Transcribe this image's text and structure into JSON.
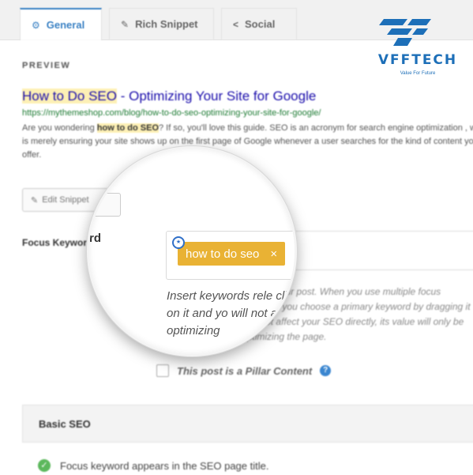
{
  "tabs": [
    {
      "label": "General",
      "icon": "gear-icon",
      "active": true
    },
    {
      "label": "Rich Snippet",
      "icon": "pin-icon",
      "active": false
    },
    {
      "label": "Social",
      "icon": "share-icon",
      "active": false
    }
  ],
  "logo": {
    "text": "VFFTECH",
    "tagline": "Value For Future",
    "color": "#1d6fb8"
  },
  "preview": {
    "heading": "PREVIEW",
    "title_keyword": "How to Do SEO",
    "title_rest": " - Optimizing Your Site for Google",
    "url": "https://mythemeshop.com/blog/how-to-do-seo-optimizing-your-site-for-google/",
    "desc_before": "Are you wondering ",
    "desc_keyword": "how to do SEO",
    "desc_after": "? If so, you'll love this guide. SEO is an acronym for search engine optimization , which is merely ensuring your site shows up on the first page of Google whenever a user searches for the kind of content you offer."
  },
  "edit_snippet": {
    "label": "Edit Snippet"
  },
  "focus_keyword": {
    "label": "Focus Keyword",
    "lens_label": "rd",
    "keyword": "how to do seo",
    "remove_symbol": "×",
    "help_text": "Insert keywords related to your post. When you use multiple focus keywords, clicking on it and you choose a primary keyword by dragging it to the first place. It will not affect your SEO directly, its value will only be used internally for optimizing the page.",
    "lens_help": "Insert keywords rele clicking on it and yo will not affect yo optimizing"
  },
  "pillar": {
    "label": "This post is a Pillar Content",
    "checked": false
  },
  "basic_seo": {
    "title": "Basic SEO",
    "checks": [
      {
        "text": "Focus keyword appears in the SEO page title.",
        "status": "pass"
      }
    ]
  },
  "colors": {
    "accent": "#3b82c4",
    "keyword_pill": "#e9b234",
    "link": "#1a0dab",
    "url": "#1e7b34",
    "pass": "#5cb85c"
  }
}
